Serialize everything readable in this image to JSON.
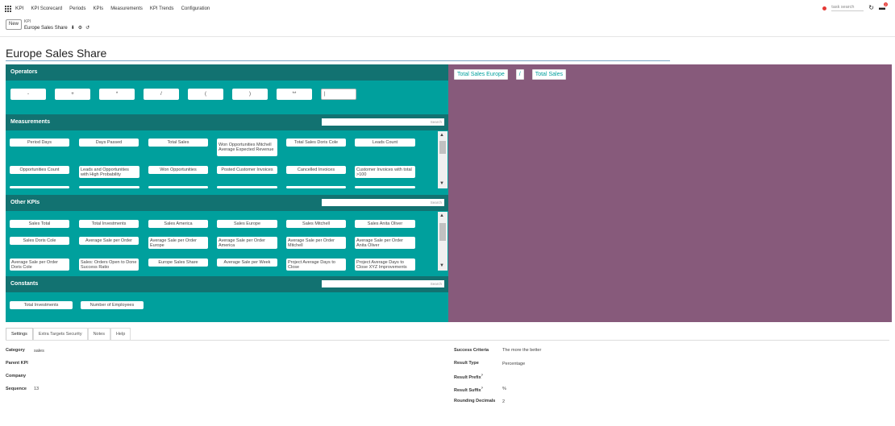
{
  "topbar": {
    "app": "KPI",
    "menus": [
      "KPI Scorecard",
      "Periods",
      "KPIs",
      "Measurements",
      "KPI Trends",
      "Configuration"
    ],
    "task_search": "task search",
    "chat_count": "2"
  },
  "controlpanel": {
    "new_label": "New",
    "breadcrumb_parent": "KPI",
    "record_name": "Europe Sales Share"
  },
  "form": {
    "title": "Europe Sales Share"
  },
  "sections": {
    "operators": "Operators",
    "measurements": "Measurements",
    "other_kpis": "Other KPIs",
    "constants": "Constants",
    "search_placeholder": "Search"
  },
  "operators": [
    "-",
    "+",
    "*",
    "/",
    "(",
    ")",
    "**",
    "|"
  ],
  "measurements": [
    "Period Days",
    "Days Passed",
    "Total Sales",
    "Won Opportunities Mitchell Average Expected Revenue",
    "Total Sales Doris Cole",
    "Leads Count",
    "Opportunities Count",
    "Leads and Opportunities with High Probability",
    "Won Opportunities",
    "Posted Customer Invoices",
    "Cancelled Invoices",
    "Customer Invoices with total >100"
  ],
  "other_kpis": [
    "Sales Total",
    "Total Investments",
    "Sales America",
    "Sales Europe",
    "Sales Mitchell",
    "Sales Anita Oliver",
    "Sales Doris Cole",
    "Average Sale per Order",
    "Average Sale per Order Europe",
    "Average Sale per Order America",
    "Average Sale per Order Mitchell",
    "Average Sale per Order Anita Oliver",
    "Average Sale per Order Doris Cole",
    "Sales: Orders Open to Done Success Ratio",
    "Europe Sales Share",
    "Average Sale per Week",
    "Project Average Days to Close",
    "Project Average Days to Close XYZ Improvements"
  ],
  "constants": [
    "Total Investments",
    "Number of Employees"
  ],
  "expression": [
    "Total Sales Europe",
    "/",
    "Total Sales"
  ],
  "tabs": [
    "Settings",
    "Extra Targets Security",
    "Notes",
    "Help"
  ],
  "fields_left": [
    {
      "label": "Category",
      "value": "sales"
    },
    {
      "label": "Parent KPI",
      "value": ""
    },
    {
      "label": "Company",
      "value": ""
    },
    {
      "label": "Sequence",
      "value": "13"
    }
  ],
  "fields_right": [
    {
      "label": "Success Criteria",
      "value": "The more the better"
    },
    {
      "label": "Result Type",
      "value": "Percentage"
    },
    {
      "label": "Result Prefix",
      "value": ""
    },
    {
      "label": "Result Suffix",
      "value": "%"
    },
    {
      "label": "Rounding Decimals",
      "value": "2"
    }
  ],
  "colors": {
    "formula_green": "#00a09d",
    "section_header": "#127271",
    "expression_purple": "#875a7b"
  }
}
